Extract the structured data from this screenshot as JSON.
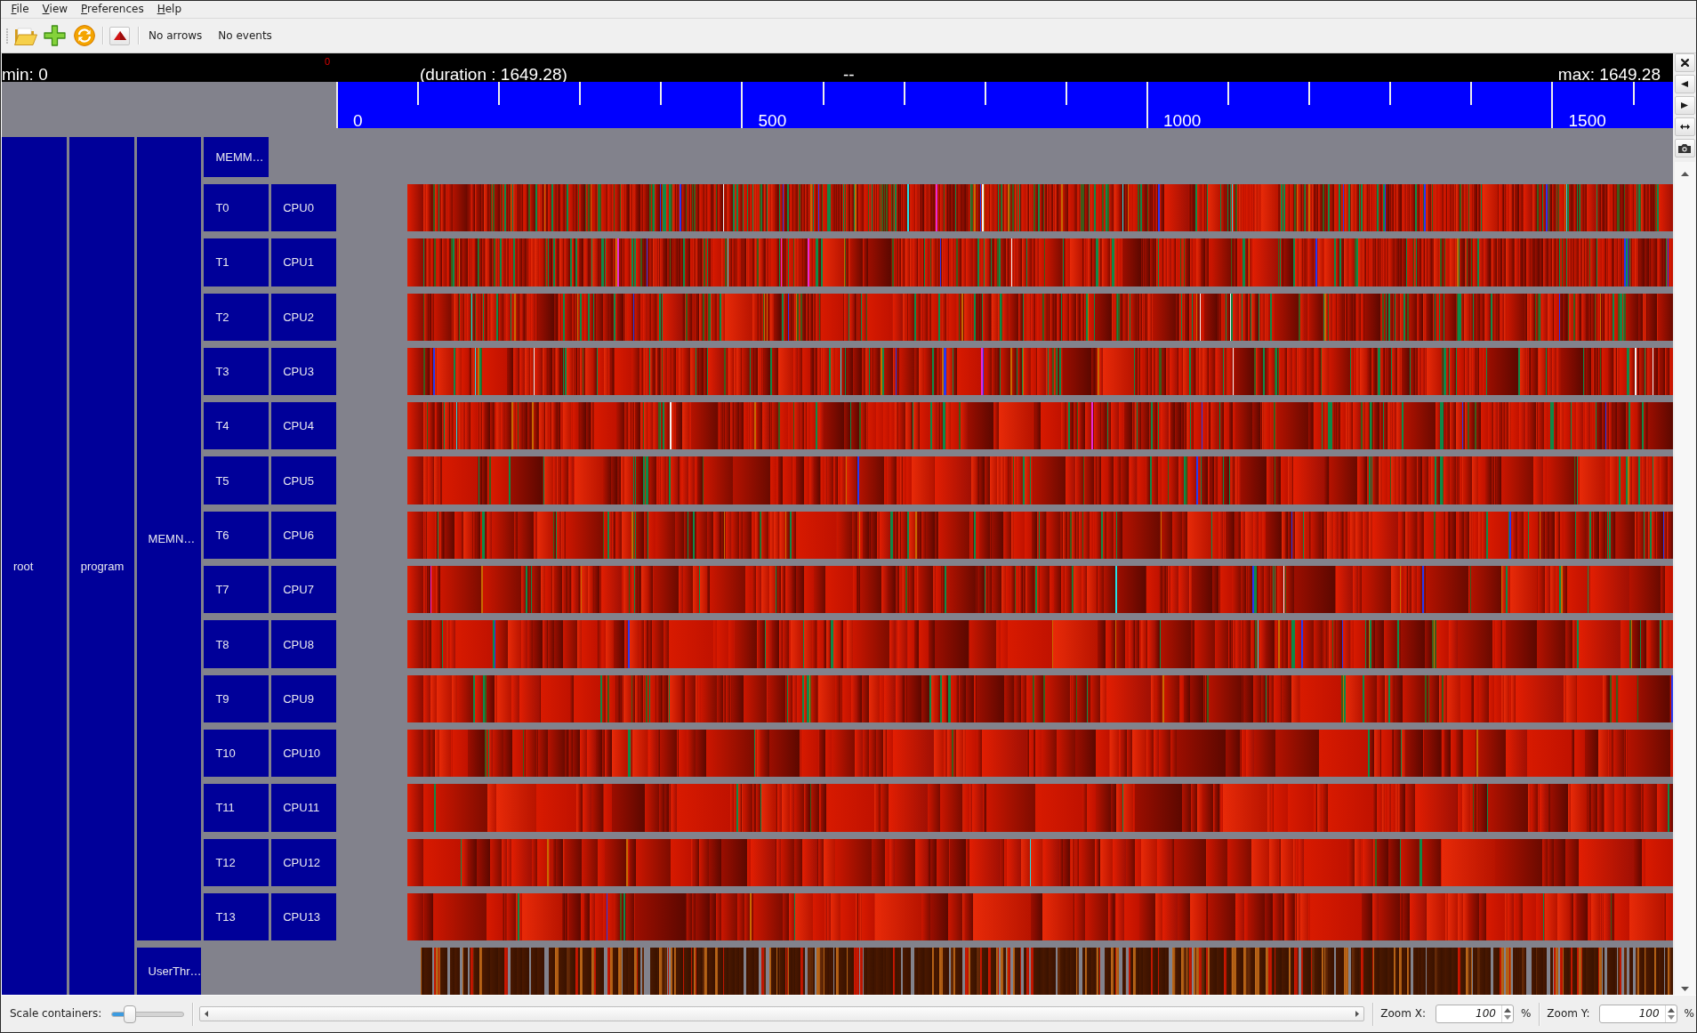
{
  "menu": [
    {
      "label": "File"
    },
    {
      "label": "View"
    },
    {
      "label": "Preferences"
    },
    {
      "label": "Help"
    }
  ],
  "toolbar": {
    "arrows_status": "No arrows",
    "events_status": "No events"
  },
  "time_header": {
    "cursor": "0",
    "min": "min: 0",
    "duration": "(duration : 1649.28)",
    "center": "--",
    "max": "max: 1649.28"
  },
  "ruler": {
    "labels": [
      "0",
      "500",
      "1000",
      "1500"
    ]
  },
  "containers": [
    {
      "label": "root",
      "children": [
        {
          "label": "program",
          "children": [
            {
              "label": "MEMN…",
              "children": [
                {
                  "label": "MEMM…",
                  "kind": "empty"
                },
                {
                  "label": "T0",
                  "children": [
                    {
                      "label": "CPU0",
                      "kind": "states"
                    }
                  ]
                },
                {
                  "label": "T1",
                  "children": [
                    {
                      "label": "CPU1",
                      "kind": "states"
                    }
                  ]
                },
                {
                  "label": "T2",
                  "children": [
                    {
                      "label": "CPU2",
                      "kind": "states"
                    }
                  ]
                },
                {
                  "label": "T3",
                  "children": [
                    {
                      "label": "CPU3",
                      "kind": "states"
                    }
                  ]
                },
                {
                  "label": "T4",
                  "children": [
                    {
                      "label": "CPU4",
                      "kind": "states"
                    }
                  ]
                },
                {
                  "label": "T5",
                  "children": [
                    {
                      "label": "CPU5",
                      "kind": "states"
                    }
                  ]
                },
                {
                  "label": "T6",
                  "children": [
                    {
                      "label": "CPU6",
                      "kind": "states"
                    }
                  ]
                },
                {
                  "label": "T7",
                  "children": [
                    {
                      "label": "CPU7",
                      "kind": "states"
                    }
                  ]
                },
                {
                  "label": "T8",
                  "children": [
                    {
                      "label": "CPU8",
                      "kind": "states"
                    }
                  ]
                },
                {
                  "label": "T9",
                  "children": [
                    {
                      "label": "CPU9",
                      "kind": "states"
                    }
                  ]
                },
                {
                  "label": "T10",
                  "children": [
                    {
                      "label": "CPU10",
                      "kind": "states"
                    }
                  ]
                },
                {
                  "label": "T11",
                  "children": [
                    {
                      "label": "CPU11",
                      "kind": "states"
                    }
                  ]
                },
                {
                  "label": "T12",
                  "children": [
                    {
                      "label": "CPU12",
                      "kind": "states"
                    }
                  ]
                },
                {
                  "label": "T13",
                  "children": [
                    {
                      "label": "CPU13",
                      "kind": "states"
                    }
                  ]
                }
              ]
            },
            {
              "label": "UserThr…",
              "kind": "events"
            }
          ]
        }
      ]
    }
  ],
  "status_bar": {
    "scale_label": "Scale containers:",
    "scale_slider": {
      "level": 0.2
    },
    "zoom_x": {
      "label": "Zoom X:",
      "value": "100",
      "unit": "%"
    },
    "zoom_y": {
      "label": "Zoom Y:",
      "value": "100",
      "unit": "%"
    }
  }
}
